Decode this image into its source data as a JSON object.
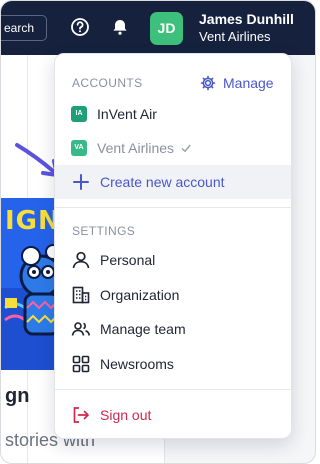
{
  "topbar": {
    "search_label": "earch",
    "user": {
      "initials": "JD",
      "name": "James Dunhill",
      "org": "Vent Airlines",
      "avatar_color": "#3cc07b"
    }
  },
  "background": {
    "promo_text": "IGN!",
    "card_title": "gn",
    "card_subtitle": "stories with"
  },
  "dropdown": {
    "accounts_label": "ACCOUNTS",
    "manage_label": "Manage",
    "accounts": [
      {
        "badge": "IA",
        "name": "InVent Air",
        "current": false
      },
      {
        "badge": "VA",
        "name": "Vent Airlines",
        "current": true
      }
    ],
    "create_label": "Create new account",
    "settings_label": "SETTINGS",
    "settings_items": [
      {
        "icon": "person-icon",
        "label": "Personal"
      },
      {
        "icon": "building-icon",
        "label": "Organization"
      },
      {
        "icon": "team-icon",
        "label": "Manage team"
      },
      {
        "icon": "grid-icon",
        "label": "Newsrooms"
      }
    ],
    "sign_out_label": "Sign out"
  },
  "colors": {
    "topbar": "#15213d",
    "accent": "#4a57c8",
    "danger": "#d0294b",
    "hint_arrow": "#5b52e0"
  }
}
